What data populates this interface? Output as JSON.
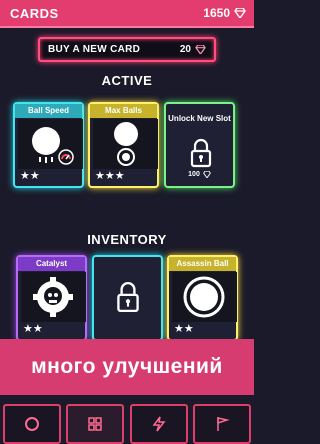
{
  "header": {
    "title": "CARDS",
    "gem_count": "1650"
  },
  "buy": {
    "label": "BUY A NEW CARD",
    "price": "20"
  },
  "sections": {
    "active": "ACTIVE",
    "inventory": "INVENTORY"
  },
  "active_cards": [
    {
      "name": "Ball Speed",
      "stars": "★★"
    },
    {
      "name": "Max Balls",
      "stars": "★★★"
    }
  ],
  "unlock_slot": {
    "label": "Unlock New Slot",
    "price": "100"
  },
  "inventory_cards": [
    {
      "name": "Catalyst",
      "stars": "★★"
    },
    {
      "name": "Assassin Ball",
      "stars": "★★"
    }
  ],
  "banner": {
    "text": "много улучшений"
  },
  "nav": [
    "circle-icon",
    "grid-icon",
    "lightning-icon",
    "flag-icon"
  ],
  "colors": {
    "accent": "#e23d6e",
    "cyan": "#43e6f0",
    "yellow": "#fff06b",
    "purple": "#b86cf5",
    "green": "#7df08a"
  }
}
